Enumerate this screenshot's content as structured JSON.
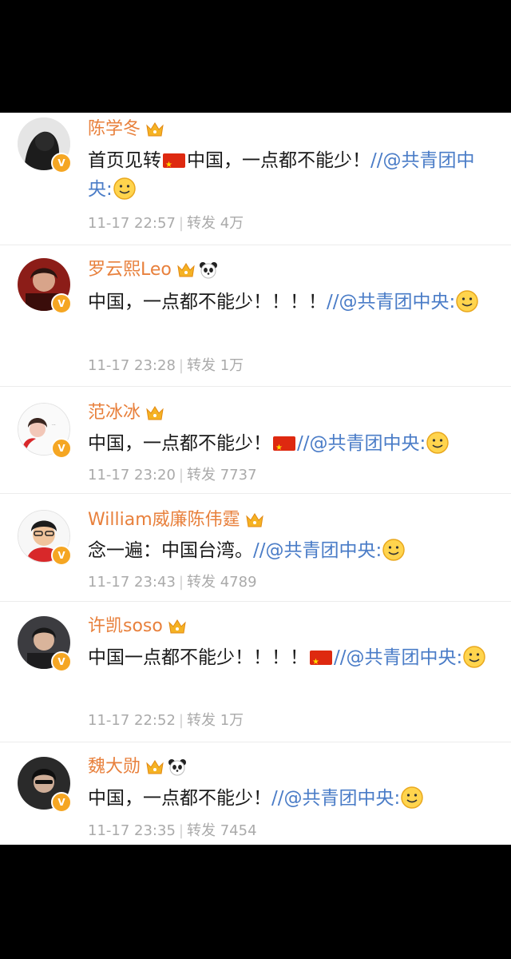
{
  "posts": [
    {
      "name": "陈学冬",
      "content_plain": "首页见转",
      "content_plain2": "中国，一点都不能少！",
      "content_link": "//@共青团中央:",
      "time": "11-17 22:57",
      "repost_label": "转发",
      "repost_count": "4万",
      "has_panda": false,
      "flag_position": "after-plain"
    },
    {
      "name": "罗云熙Leo",
      "content_plain": "中国，一点都不能少！！！！",
      "content_plain2": "",
      "content_link": "//@共青团中央:",
      "time": "11-17 23:28",
      "repost_label": "转发",
      "repost_count": "1万",
      "has_panda": true,
      "flag_position": "none"
    },
    {
      "name": "范冰冰",
      "content_plain": "中国，一点都不能少！",
      "content_plain2": "",
      "content_link": "//@共青团中央:",
      "time": "11-17 23:20",
      "repost_label": "转发",
      "repost_count": "7737",
      "has_panda": false,
      "flag_position": "before-link"
    },
    {
      "name": "William威廉陈伟霆",
      "content_plain": "念一遍：中国台湾。",
      "content_plain2": "",
      "content_link": "//@共青团中央:",
      "time": "11-17 23:43",
      "repost_label": "转发",
      "repost_count": "4789",
      "has_panda": false,
      "flag_position": "none"
    },
    {
      "name": "许凯soso",
      "content_plain": "中国一点都不能少！！！！",
      "content_plain2": "",
      "content_link": "//@共青团中央:",
      "time": "11-17 22:52",
      "repost_label": "转发",
      "repost_count": "1万",
      "has_panda": false,
      "flag_position": "before-link"
    },
    {
      "name": "魏大勋",
      "content_plain": "中国，一点都不能少！",
      "content_plain2": "",
      "content_link": "//@共青团中央:",
      "time": "11-17 23:35",
      "repost_label": "转发",
      "repost_count": "7454",
      "has_panda": true,
      "flag_position": "none"
    }
  ],
  "colors": {
    "name": "#e8803c",
    "link": "#4a7cc7",
    "meta": "#aaaaaa",
    "badge": "#f5a623"
  },
  "icons": {
    "verified": "verified-v-icon",
    "crown": "vip-crown-icon",
    "panda": "panda-icon",
    "flag": "china-flag-icon",
    "smile": "smile-emoji-icon"
  }
}
